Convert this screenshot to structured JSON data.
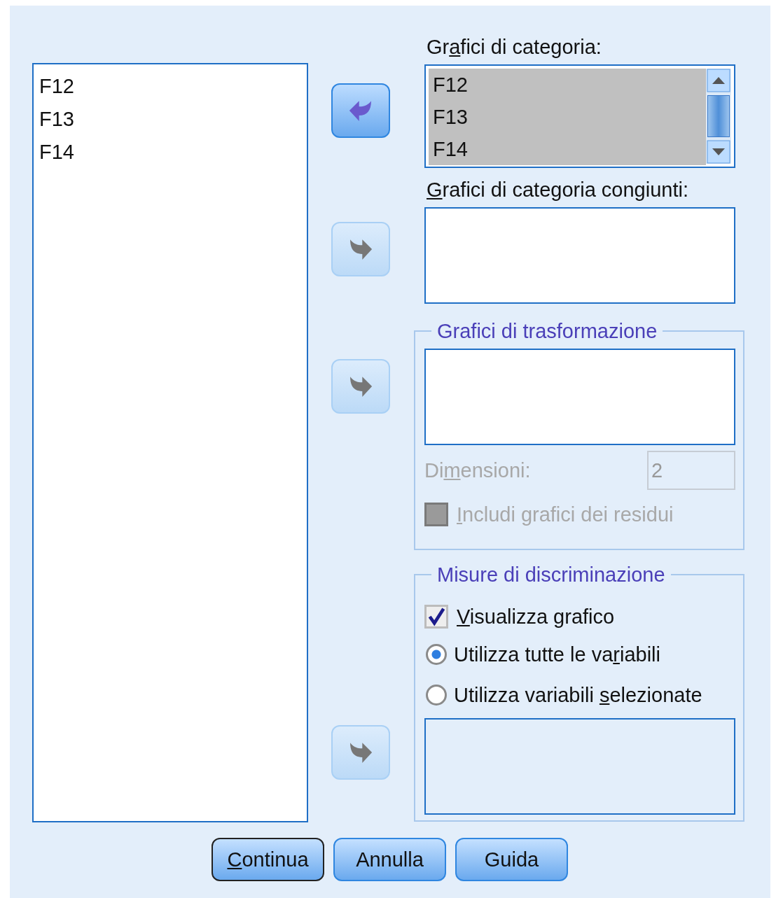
{
  "source_list": {
    "items": [
      {
        "label": "F12",
        "selected": false
      },
      {
        "label": "F13",
        "selected": false
      },
      {
        "label": "F14",
        "selected": false
      }
    ]
  },
  "arrow_buttons": [
    {
      "kind": "move-back",
      "disabled": false
    },
    {
      "kind": "move-to",
      "disabled": true
    },
    {
      "kind": "move-to",
      "disabled": true
    },
    {
      "kind": "move-to",
      "disabled": true
    }
  ],
  "category_plots": {
    "label": {
      "pre": "Gr",
      "key": "a",
      "post": "fici di categoria:"
    },
    "items": [
      {
        "label": "F12",
        "selected": true
      },
      {
        "label": "F13",
        "selected": true
      },
      {
        "label": "F14",
        "selected": true
      }
    ]
  },
  "joint_category_plots": {
    "label": {
      "key": "G",
      "post": "rafici di categoria congiunti:"
    }
  },
  "transformation_plots": {
    "title": "Grafici di trasformazione",
    "dimensions": {
      "label": {
        "pre": "Di",
        "key": "m",
        "post": "ensioni:"
      },
      "value": "2",
      "disabled": true
    },
    "include_residuals": {
      "label": {
        "key": "I",
        "post": "ncludi grafici dei residui"
      },
      "checked": false,
      "disabled": true
    }
  },
  "discrimination_measures": {
    "title": "Misure di discriminazione",
    "show_plot": {
      "label": {
        "key": "V",
        "post": "isualizza grafico"
      },
      "checked": true,
      "disabled": false
    },
    "variable_options": [
      {
        "label": {
          "pre": "Utilizza tutte le va",
          "key": "r",
          "post": "iabili"
        },
        "selected": true
      },
      {
        "label": {
          "pre": "Utilizza variabili ",
          "key": "s",
          "post": "elezionate"
        },
        "selected": false
      }
    ]
  },
  "buttons": [
    {
      "label": {
        "key": "C",
        "post": "ontinua"
      },
      "default": true
    },
    {
      "label": {
        "post": "Annulla"
      },
      "default": false
    },
    {
      "label": {
        "post": "Guida"
      },
      "default": false
    }
  ]
}
